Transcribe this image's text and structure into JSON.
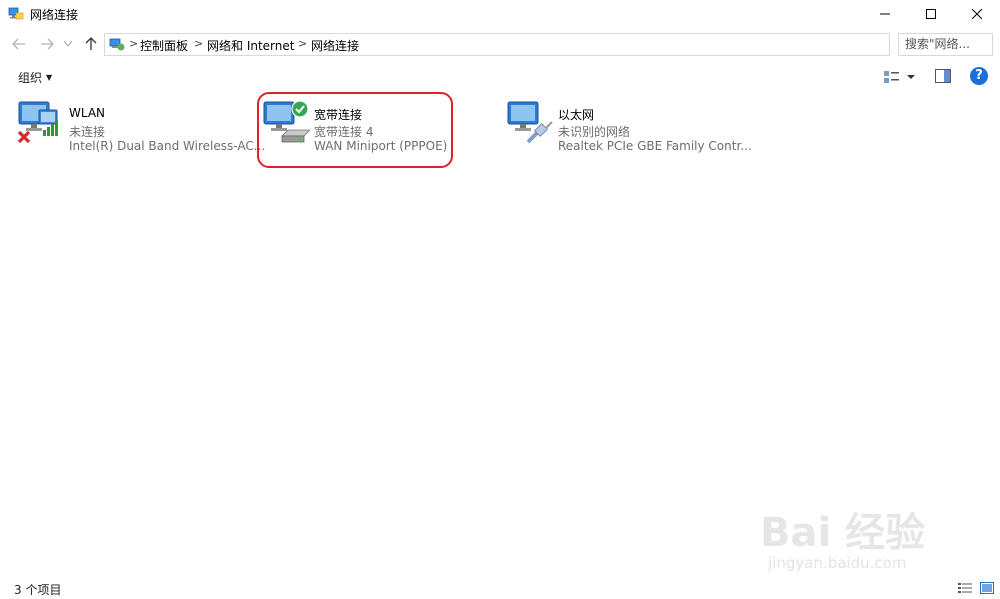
{
  "window": {
    "title": "网络连接",
    "app_icon": "network-connections-icon"
  },
  "window_controls": {
    "minimize": "minimize-icon",
    "maximize": "maximize-icon",
    "close": "close-icon"
  },
  "nav": {
    "back_icon": "back-arrow-icon",
    "forward_icon": "forward-arrow-icon",
    "recent_icon": "chevron-down-icon",
    "up_icon": "up-arrow-icon",
    "breadcrumbs": [
      "控制面板",
      "网络和 Internet",
      "网络连接"
    ],
    "search_placeholder": "搜索\"网络..."
  },
  "toolbar": {
    "organize_label": "组织",
    "help_label": "?"
  },
  "connections": [
    {
      "name": "WLAN",
      "status": "未连接",
      "device": "Intel(R) Dual Band Wireless-AC...",
      "icon": "wlan-adapter-icon",
      "overlay": "disconnected-x-icon"
    },
    {
      "name": "宽带连接",
      "status": "宽带连接 4",
      "device": "WAN Miniport (PPPOE)",
      "icon": "broadband-connection-icon",
      "overlay": "connected-check-icon",
      "highlighted": true
    },
    {
      "name": "以太网",
      "status": "未识别的网络",
      "device": "Realtek PCIe GBE Family Contr...",
      "icon": "ethernet-adapter-icon",
      "overlay": "ethernet-cable-icon"
    }
  ],
  "status": {
    "count": "3 个项目"
  },
  "colors": {
    "highlight": "#e0202a",
    "help": "#1a6fd8",
    "signal": "#2e9a2e"
  },
  "watermark": {
    "main": "Bai 经验",
    "sub": "jingyan.baidu.com"
  }
}
